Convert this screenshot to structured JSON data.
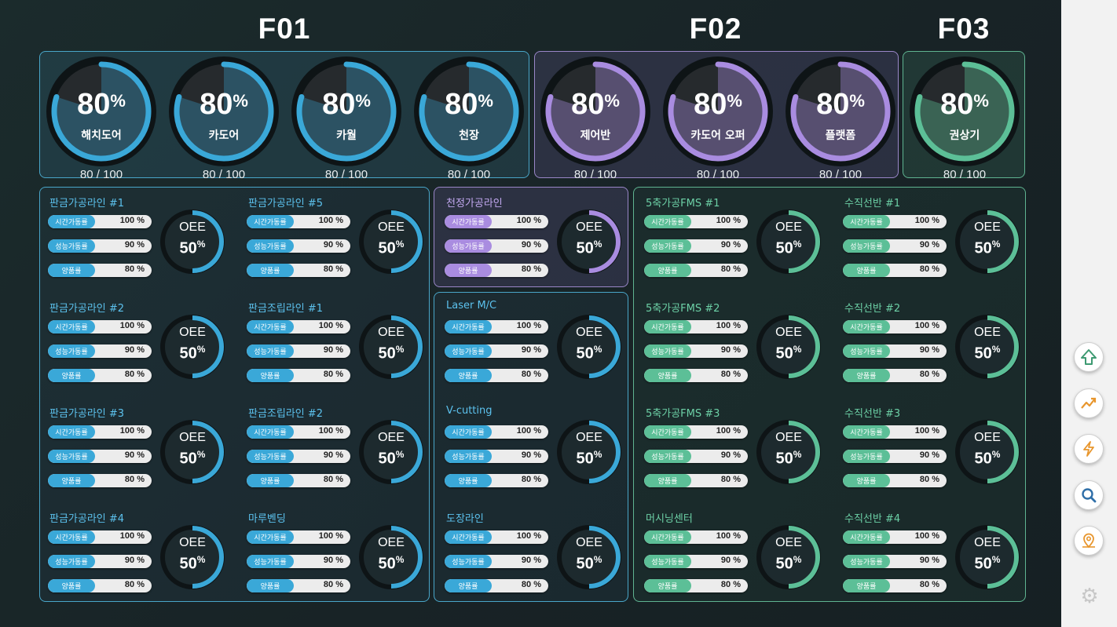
{
  "factories": [
    "F01",
    "F02",
    "F03"
  ],
  "colors": {
    "blue": "#3aa8d8",
    "purple": "#a98ce0",
    "green": "#5cbf97",
    "track": "#0e1416"
  },
  "gauges": [
    {
      "group": "blue",
      "pct": "80",
      "unit": "%",
      "name": "해치도어",
      "count": "80 / 100",
      "value": 0.8
    },
    {
      "group": "blue",
      "pct": "80",
      "unit": "%",
      "name": "카도어",
      "count": "80 / 100",
      "value": 0.8
    },
    {
      "group": "blue",
      "pct": "80",
      "unit": "%",
      "name": "카월",
      "count": "80 / 100",
      "value": 0.8
    },
    {
      "group": "blue",
      "pct": "80",
      "unit": "%",
      "name": "천장",
      "count": "80 / 100",
      "value": 0.8
    },
    {
      "group": "purple",
      "pct": "80",
      "unit": "%",
      "name": "제어반",
      "count": "80 / 100",
      "value": 0.8
    },
    {
      "group": "purple",
      "pct": "80",
      "unit": "%",
      "name": "카도어 오퍼",
      "count": "80 / 100",
      "value": 0.8
    },
    {
      "group": "purple",
      "pct": "80",
      "unit": "%",
      "name": "플랫폼",
      "count": "80 / 100",
      "value": 0.8
    },
    {
      "group": "green",
      "pct": "80",
      "unit": "%",
      "name": "권상기",
      "count": "80 / 100",
      "value": 0.8
    }
  ],
  "metric_labels": [
    "시간가동률",
    "성능가동률",
    "양품률"
  ],
  "oee_label": "OEE",
  "lines": [
    {
      "group": "blue",
      "title": "판금가공라인 #1",
      "m": [
        "100 %",
        "90 %",
        "80 %"
      ],
      "oee": "50",
      "unit": "%"
    },
    {
      "group": "blue",
      "title": "판금가공라인 #5",
      "m": [
        "100 %",
        "90 %",
        "80 %"
      ],
      "oee": "50",
      "unit": "%"
    },
    {
      "group": "purple",
      "title": "천정가공라인",
      "m": [
        "100 %",
        "90 %",
        "80 %"
      ],
      "oee": "50",
      "unit": "%"
    },
    {
      "group": "green",
      "title": "5축가공FMS #1",
      "m": [
        "100 %",
        "90 %",
        "80 %"
      ],
      "oee": "50",
      "unit": "%"
    },
    {
      "group": "green",
      "title": "수직선반 #1",
      "m": [
        "100 %",
        "90 %",
        "80 %"
      ],
      "oee": "50",
      "unit": "%"
    },
    {
      "group": "blue",
      "title": "판금가공라인 #2",
      "m": [
        "100 %",
        "90 %",
        "80 %"
      ],
      "oee": "50",
      "unit": "%"
    },
    {
      "group": "blue",
      "title": "판금조립라인 #1",
      "m": [
        "100 %",
        "90 %",
        "80 %"
      ],
      "oee": "50",
      "unit": "%"
    },
    {
      "group": "blue",
      "title": "Laser M/C",
      "m": [
        "100 %",
        "90 %",
        "80 %"
      ],
      "oee": "50",
      "unit": "%"
    },
    {
      "group": "green",
      "title": "5축가공FMS #2",
      "m": [
        "100 %",
        "90 %",
        "80 %"
      ],
      "oee": "50",
      "unit": "%"
    },
    {
      "group": "green",
      "title": "수직선반 #2",
      "m": [
        "100 %",
        "90 %",
        "80 %"
      ],
      "oee": "50",
      "unit": "%"
    },
    {
      "group": "blue",
      "title": "판금가공라인 #3",
      "m": [
        "100 %",
        "90 %",
        "80 %"
      ],
      "oee": "50",
      "unit": "%"
    },
    {
      "group": "blue",
      "title": "판금조립라인 #2",
      "m": [
        "100 %",
        "90 %",
        "80 %"
      ],
      "oee": "50",
      "unit": "%"
    },
    {
      "group": "blue",
      "title": "V-cutting",
      "m": [
        "100 %",
        "90 %",
        "80 %"
      ],
      "oee": "50",
      "unit": "%"
    },
    {
      "group": "green",
      "title": "5축가공FMS #3",
      "m": [
        "100 %",
        "90 %",
        "80 %"
      ],
      "oee": "50",
      "unit": "%"
    },
    {
      "group": "green",
      "title": "수직선반 #3",
      "m": [
        "100 %",
        "90 %",
        "80 %"
      ],
      "oee": "50",
      "unit": "%"
    },
    {
      "group": "blue",
      "title": "판금가공라인 #4",
      "m": [
        "100 %",
        "90 %",
        "80 %"
      ],
      "oee": "50",
      "unit": "%"
    },
    {
      "group": "blue",
      "title": "마루벤딩",
      "m": [
        "100 %",
        "90 %",
        "80 %"
      ],
      "oee": "50",
      "unit": "%"
    },
    {
      "group": "blue",
      "title": "도장라인",
      "m": [
        "100 %",
        "90 %",
        "80 %"
      ],
      "oee": "50",
      "unit": "%"
    },
    {
      "group": "green",
      "title": "머시닝센터",
      "m": [
        "100 %",
        "90 %",
        "80 %"
      ],
      "oee": "50",
      "unit": "%"
    },
    {
      "group": "green",
      "title": "수직선반 #4",
      "m": [
        "100 %",
        "90 %",
        "80 %"
      ],
      "oee": "50",
      "unit": "%"
    }
  ],
  "sidebar": [
    "home-upload-icon",
    "trend-chart-icon",
    "lightning-icon",
    "search-icon",
    "location-pin-icon",
    "gear-icon"
  ]
}
